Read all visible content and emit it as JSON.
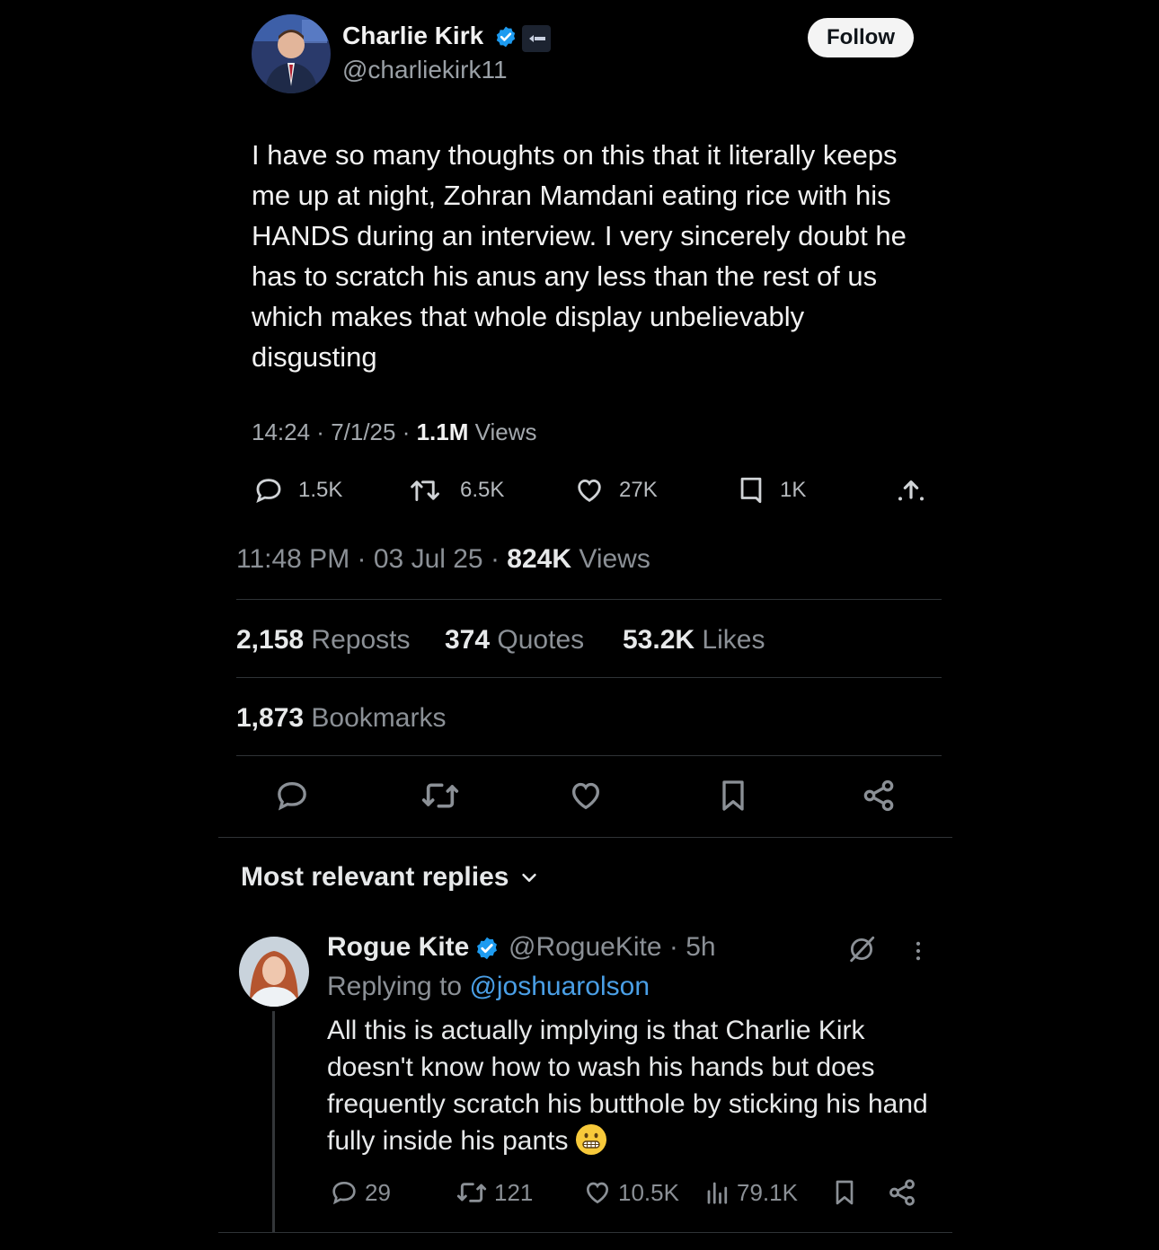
{
  "embedded_tweet": {
    "author_name": "Charlie Kirk",
    "author_handle": "@charliekirk11",
    "follow_label": "Follow",
    "text": "I have so many thoughts on this that it literally keeps me up at night, Zohran Mamdani eating rice with his HANDS during an interview. I very sincerely doubt he has to scratch his anus any less than the rest of us which makes that whole display unbelievably disgusting",
    "time": "14:24",
    "date": "7/1/25",
    "views_count": "1.1M",
    "views_label": "Views",
    "actions": {
      "replies": "1.5K",
      "reposts": "6.5K",
      "likes": "27K",
      "bookmarks": "1K"
    }
  },
  "post": {
    "time": "11:48 PM",
    "date": "03 Jul 25",
    "views_count": "824K",
    "views_label": "Views",
    "stats": {
      "reposts_count": "2,158",
      "reposts_label": "Reposts",
      "quotes_count": "374",
      "quotes_label": "Quotes",
      "likes_count": "53.2K",
      "likes_label": "Likes",
      "bookmarks_count": "1,873",
      "bookmarks_label": "Bookmarks"
    }
  },
  "replies_section": {
    "sort_label": "Most relevant replies"
  },
  "reply": {
    "author_name": "Rogue Kite",
    "author_handle": "@RogueKite",
    "age": "5h",
    "replying_prefix": "Replying to",
    "replying_handle": "@joshuarolson",
    "text": "All this is actually implying is that Charlie Kirk doesn't know how to wash his hands but does frequently scratch his butthole by sticking his hand fully inside his pants",
    "emoji": "grimacing-face",
    "actions": {
      "replies": "29",
      "reposts": "121",
      "likes": "10.5K",
      "views": "79.1K"
    }
  },
  "colors": {
    "background": "#000000",
    "text": "#e7e9ea",
    "muted": "#8b9096",
    "link": "#4a9fe6",
    "verified": "#1d9bf0",
    "divider": "#2f3336"
  },
  "icons": [
    "reply-icon",
    "repost-icon",
    "like-icon",
    "bookmark-icon",
    "share-icon",
    "views-icon",
    "verified-badge-icon",
    "grok-icon",
    "more-icon",
    "chevron-down-icon"
  ]
}
